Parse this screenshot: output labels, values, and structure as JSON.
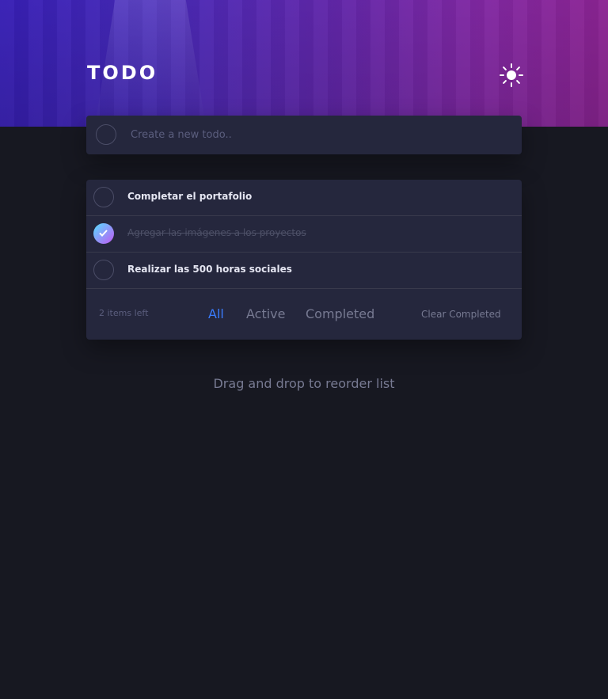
{
  "header": {
    "title": "TODO",
    "theme_toggle_icon": "sun-icon"
  },
  "new_todo": {
    "placeholder": "Create a new todo..",
    "value": ""
  },
  "todos": [
    {
      "text": "Completar el portafolio",
      "completed": false
    },
    {
      "text": "Agregar las imágenes a los proyectos",
      "completed": true
    },
    {
      "text": "Realizar las 500 horas sociales",
      "completed": false
    }
  ],
  "footer": {
    "items_left": "2 items left",
    "filters": [
      "All",
      "Active",
      "Completed"
    ],
    "active_filter": "All",
    "clear_label": "Clear Completed"
  },
  "hint": "Drag and drop to reorder list",
  "colors": {
    "accent": "#3a7cfd",
    "check_gradient_start": "#57ddff",
    "check_gradient_end": "#c058f3",
    "card": "#25273d",
    "background": "#171821"
  }
}
